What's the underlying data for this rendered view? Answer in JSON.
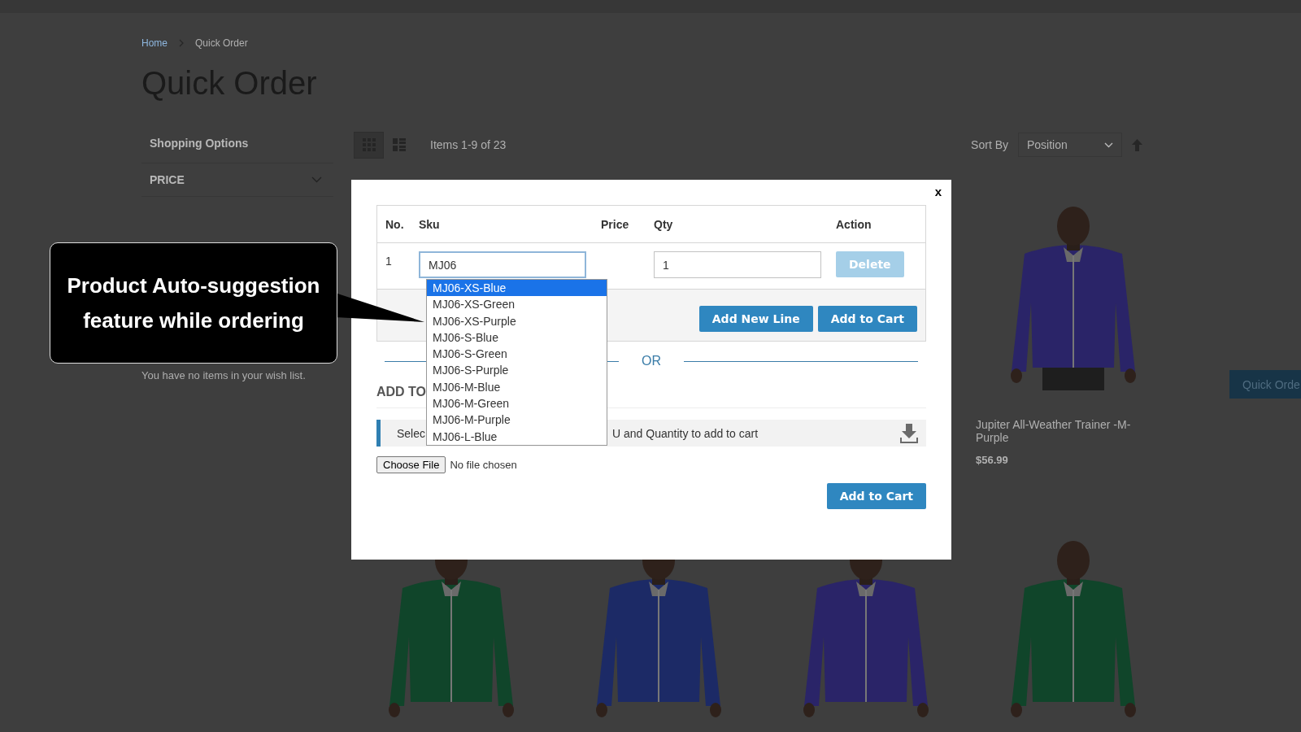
{
  "breadcrumbs": [
    {
      "label": "Home",
      "kind": "link"
    },
    {
      "label": "Quick Order",
      "kind": "current"
    }
  ],
  "page_title": "Quick Order",
  "sidebar": {
    "title": "Shopping Options",
    "filters": [
      {
        "label": "PRICE",
        "expanded": false
      }
    ],
    "wishlist_text": "You have no items in your wish list."
  },
  "toolbar": {
    "view_modes": [
      {
        "kind": "grid",
        "selected": true
      },
      {
        "kind": "list",
        "selected": false
      }
    ],
    "items_count": "Items 1-9 of 23",
    "sort_label": "Sort By",
    "sort_value": "Position"
  },
  "products": [
    {
      "kind": "picture",
      "color": "#2a2468",
      "name": "Jupiter All-Weather Trainer -M-Purple",
      "price": "$56.99"
    },
    {
      "kind": "picture",
      "color": "#10452a"
    },
    {
      "kind": "picture",
      "color": "#1c2a66"
    },
    {
      "kind": "picture",
      "color": "#2a2468"
    },
    {
      "kind": "picture",
      "color": "#10452a"
    }
  ],
  "quick_order_tab": "Quick Orde",
  "modal": {
    "close": "x",
    "columns": [
      "No.",
      "Sku",
      "Price",
      "Qty",
      "Action"
    ],
    "rows": [
      {
        "no": "1",
        "sku": "MJ06",
        "focused": true,
        "qty": "1",
        "action": "Delete",
        "disabled": true
      }
    ],
    "buttons": [
      "Add New Line",
      "Add to Cart"
    ],
    "divider": "OR",
    "upload_heading": "ADD TO",
    "hint_parts": [
      "Selec",
      "U and Quantity to add to cart"
    ],
    "file_button": "Choose File",
    "file_status": "No file chosen",
    "submit": "Add to Cart",
    "suggestions": [
      {
        "label": "MJ06-XS-Blue",
        "selected": true
      },
      {
        "label": "MJ06-XS-Green",
        "selected": false
      },
      {
        "label": "MJ06-XS-Purple",
        "selected": false
      },
      {
        "label": "MJ06-S-Blue",
        "selected": false
      },
      {
        "label": "MJ06-S-Green",
        "selected": false
      },
      {
        "label": "MJ06-S-Purple",
        "selected": false
      },
      {
        "label": "MJ06-M-Blue",
        "selected": false
      },
      {
        "label": "MJ06-M-Green",
        "selected": false
      },
      {
        "label": "MJ06-M-Purple",
        "selected": false
      },
      {
        "label": "MJ06-L-Blue",
        "selected": false
      }
    ]
  },
  "callout": "Product Auto-suggestion feature while ordering"
}
